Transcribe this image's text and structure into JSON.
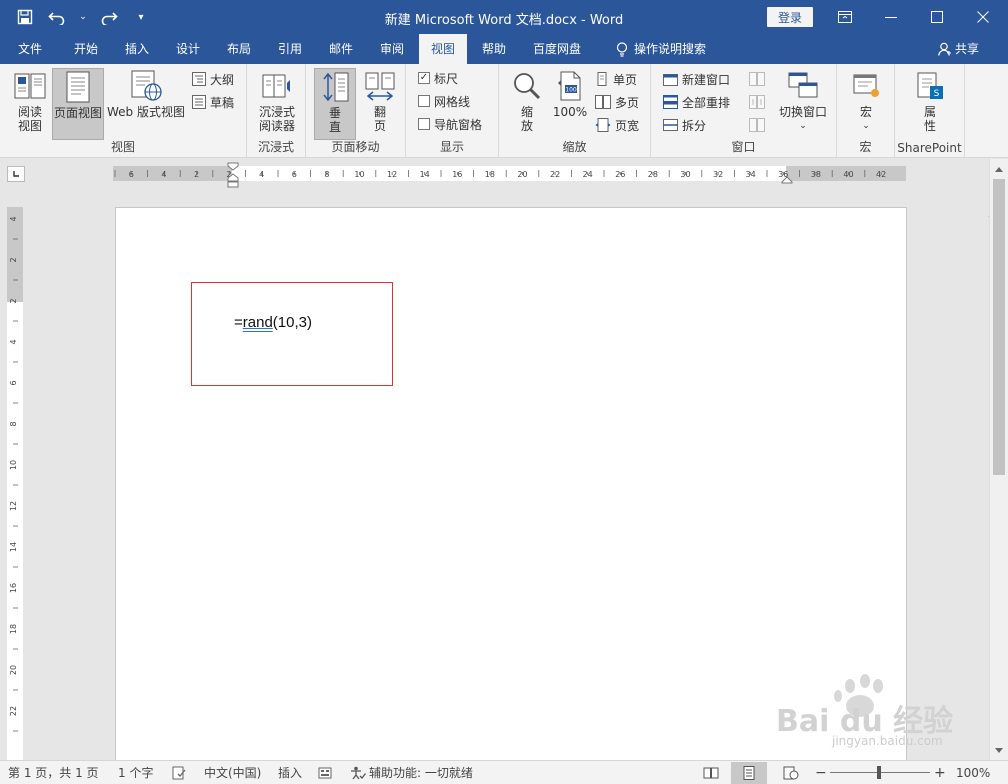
{
  "titlebar": {
    "title": "新建 Microsoft Word 文档.docx  -  Word",
    "login_label": "登录",
    "qat_dropdown": "▾"
  },
  "tabs": [
    {
      "label": "文件"
    },
    {
      "label": "开始"
    },
    {
      "label": "插入"
    },
    {
      "label": "设计"
    },
    {
      "label": "布局"
    },
    {
      "label": "引用"
    },
    {
      "label": "邮件"
    },
    {
      "label": "审阅"
    },
    {
      "label": "视图"
    },
    {
      "label": "帮助"
    },
    {
      "label": "百度网盘"
    },
    {
      "label": "操作说明搜索"
    }
  ],
  "share_label": "共享",
  "ribbon": {
    "views": {
      "group_label": "视图",
      "read_mode": "阅读\n视图",
      "print_layout": "页面视图",
      "web_layout": "Web 版式视图",
      "outline": "大纲",
      "draft": "草稿"
    },
    "immersive": {
      "group_label": "沉浸式",
      "reader": "沉浸式\n阅读器"
    },
    "page_movement": {
      "group_label": "页面移动",
      "vertical": "垂\n直",
      "side": "翻\n页"
    },
    "show": {
      "group_label": "显示",
      "ruler": "标尺",
      "gridlines": "网格线",
      "nav_pane": "导航窗格",
      "ruler_checked": true
    },
    "zoom": {
      "group_label": "缩放",
      "zoom": "缩\n放",
      "hundred": "100%",
      "one_page": "单页",
      "multiple_pages": "多页",
      "page_width": "页宽"
    },
    "window": {
      "group_label": "窗口",
      "new_window": "新建窗口",
      "arrange_all": "全部重排",
      "split": "拆分",
      "switch_windows": "切换窗口"
    },
    "macros": {
      "group_label": "宏",
      "macros": "宏"
    },
    "sharepoint": {
      "group_label": "SharePoint",
      "properties": "属\n性"
    }
  },
  "ruler": {
    "h_labels": [
      "6",
      "4",
      "2",
      "2",
      "4",
      "6",
      "8",
      "10",
      "12",
      "14",
      "16",
      "18",
      "20",
      "22",
      "24",
      "26",
      "28",
      "30",
      "32",
      "34",
      "36",
      "38",
      "40",
      "42"
    ],
    "v_labels": [
      "4",
      "2",
      "2",
      "4",
      "6",
      "8",
      "10",
      "12",
      "14",
      "16",
      "18",
      "20",
      "22"
    ]
  },
  "document": {
    "eq": "=",
    "fn": "rand",
    "args": "(10,3)"
  },
  "statusbar": {
    "page": "第 1 页，共 1 页",
    "words": "1 个字",
    "lang": "中文(中国)",
    "mode": "插入",
    "accessibility": "辅助功能: 一切就绪",
    "zoom_level": "100%",
    "zoom_minus": "−",
    "zoom_plus": "+"
  },
  "watermark": {
    "brand": "Bai du 经验",
    "url": "jingyan.baidu.com"
  },
  "colors": {
    "accent": "#2b579a",
    "ribbon_bg": "#f3f3f3",
    "highlight_box": "#e03030",
    "proof_underline": "#2f6fd6"
  }
}
